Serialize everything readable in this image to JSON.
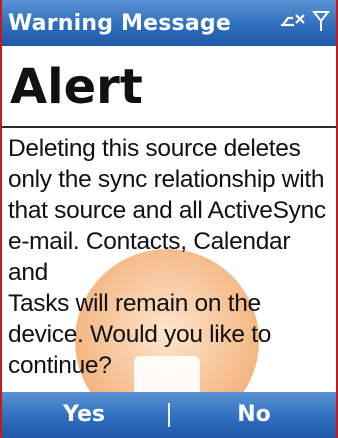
{
  "titlebar": {
    "title": "Warning Message",
    "icons": [
      "sync-disconnected-icon",
      "signal-icon"
    ]
  },
  "header": {
    "title": "Alert"
  },
  "message": "Deleting this source deletes\nonly the sync relationship with\nthat source and all ActiveSync\ne-mail. Contacts, Calendar and\nTasks will remain on the\ndevice. Would you like to\ncontinue?",
  "watermark": {
    "icon": "warning-icon"
  },
  "softkeys": {
    "left": "Yes",
    "right": "No"
  },
  "colors": {
    "bar": "#2f6fbf",
    "frame": "#c41a1a",
    "watermark": "#f2a25f"
  }
}
